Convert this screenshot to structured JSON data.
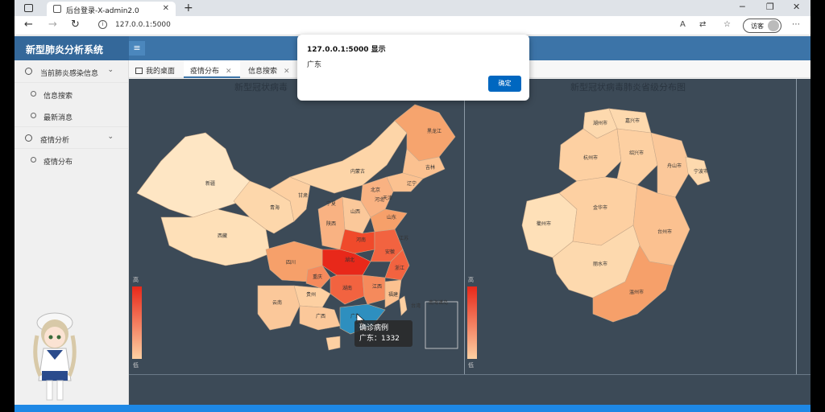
{
  "browser": {
    "tab_title": "后台登录-X-admin2.0",
    "url": "127.0.0.1:5000",
    "guest_label": "访客"
  },
  "app": {
    "brand": "新型肺炎分析系统"
  },
  "sidebar": {
    "groups": [
      {
        "label": "当前肺炎感染信息",
        "items": [
          "信息搜索",
          "最新消息"
        ]
      },
      {
        "label": "疫情分析",
        "items": [
          "疫情分布"
        ]
      }
    ]
  },
  "content_tabs": [
    {
      "label": "我的桌面"
    },
    {
      "label": "疫情分布"
    },
    {
      "label": "信息搜索"
    }
  ],
  "charts": {
    "left_title": "新型冠状病毒",
    "right_title": "新型冠状病毒肺炎省级分布图",
    "legend_high": "高",
    "legend_low": "低",
    "china_regions": [
      "新疆",
      "西藏",
      "青海",
      "甘肃",
      "宁夏",
      "内蒙古",
      "黑龙江",
      "吉林",
      "辽宁",
      "北京",
      "天津",
      "河北",
      "山西",
      "陕西",
      "四川",
      "重庆",
      "云南",
      "贵州",
      "广西",
      "广东",
      "湖南",
      "湖北",
      "江西",
      "安徽",
      "江苏",
      "浙江",
      "福建",
      "山东",
      "河南",
      "台湾",
      "南海诸岛"
    ],
    "zhejiang_cities": [
      "湖州市",
      "嘉兴市",
      "杭州市",
      "绍兴市",
      "舟山市",
      "宁波市",
      "衢州市",
      "金华市",
      "台州市",
      "丽水市",
      "温州市"
    ]
  },
  "tooltip": {
    "title": "确诊病例",
    "line": "广东：1332"
  },
  "dialog": {
    "title": "127.0.0.1:5000 显示",
    "message": "广东",
    "ok_label": "确定"
  },
  "colors": {
    "header": "#3c74a8",
    "chart_bg": "#3c4a57",
    "highlight": "#2e8fbf",
    "hot": "#e8281a",
    "cool": "#fdd0a2"
  }
}
